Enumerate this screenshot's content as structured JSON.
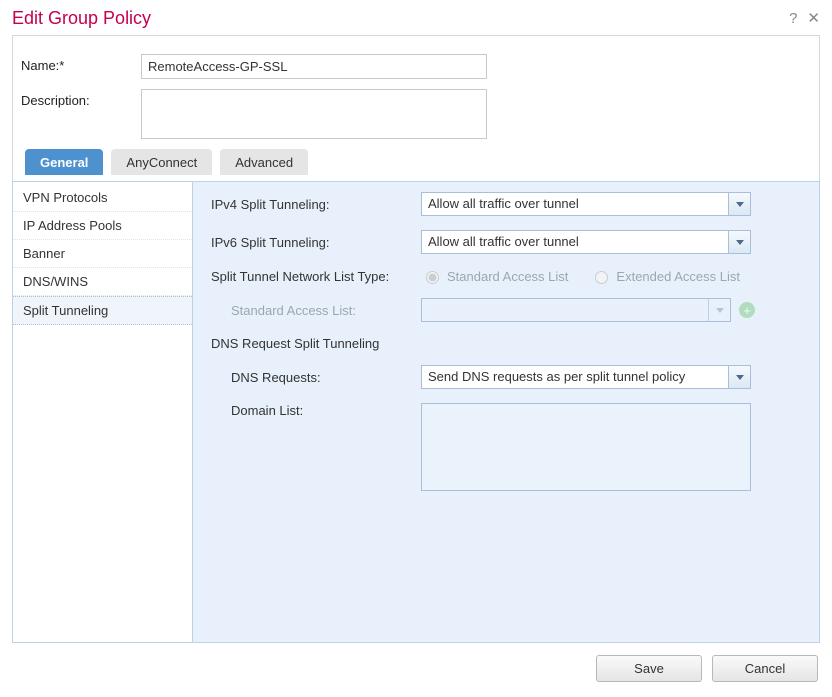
{
  "title": "Edit Group Policy",
  "form": {
    "name_label": "Name:*",
    "name_value": "RemoteAccess-GP-SSL",
    "description_label": "Description:",
    "description_value": ""
  },
  "tabs": [
    {
      "label": "General",
      "active": true
    },
    {
      "label": "AnyConnect",
      "active": false
    },
    {
      "label": "Advanced",
      "active": false
    }
  ],
  "sidebar": [
    {
      "label": "VPN Protocols",
      "active": false
    },
    {
      "label": "IP Address Pools",
      "active": false
    },
    {
      "label": "Banner",
      "active": false
    },
    {
      "label": "DNS/WINS",
      "active": false
    },
    {
      "label": "Split Tunneling",
      "active": true
    }
  ],
  "split_tunneling": {
    "ipv4_label": "IPv4 Split Tunneling:",
    "ipv4_value": "Allow all traffic over tunnel",
    "ipv6_label": "IPv6 Split Tunneling:",
    "ipv6_value": "Allow all traffic over tunnel",
    "network_list_type_label": "Split Tunnel Network List Type:",
    "radios": {
      "standard": "Standard Access List",
      "extended": "Extended Access List",
      "selected": "standard"
    },
    "standard_access_list_label": "Standard Access List:",
    "standard_access_list_value": "",
    "dns_heading": "DNS Request Split Tunneling",
    "dns_requests_label": "DNS Requests:",
    "dns_requests_value": "Send DNS requests as per split tunnel policy",
    "domain_list_label": "Domain List:"
  },
  "buttons": {
    "save": "Save",
    "cancel": "Cancel"
  }
}
